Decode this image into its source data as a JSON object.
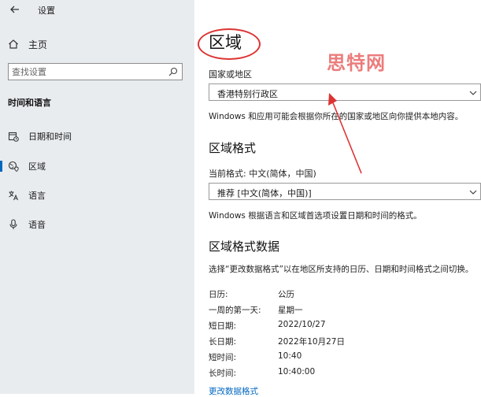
{
  "window": {
    "title": "设置"
  },
  "sidebar": {
    "home_label": "主页",
    "search_placeholder": "查找设置",
    "section_title": "时间和语言",
    "items": [
      {
        "label": "日期和时间",
        "icon": "calendar-clock-icon"
      },
      {
        "label": "区域",
        "icon": "region-icon"
      },
      {
        "label": "语言",
        "icon": "language-icon"
      },
      {
        "label": "语音",
        "icon": "microphone-icon"
      }
    ]
  },
  "main": {
    "title": "区域",
    "watermark": "思特网",
    "country_label": "国家或地区",
    "country_value": "香港特别行政区",
    "country_desc": "Windows 和应用可能会根据你所在的国家或地区向你提供本地内容。",
    "format_heading": "区域格式",
    "current_format_label": "当前格式: 中文(简体，中国)",
    "format_value": "推荐 [中文(简体，中国)]",
    "format_desc": "Windows 根据语言和区域首选项设置日期和时间的格式。",
    "data_heading": "区域格式数据",
    "data_desc": "选择“更改数据格式”以在地区所支持的日历、日期和时间格式之间切换。",
    "rows": [
      {
        "label": "日历:",
        "value": "公历"
      },
      {
        "label": "一周的第一天:",
        "value": "星期一"
      },
      {
        "label": "短日期:",
        "value": "2022/10/27"
      },
      {
        "label": "长日期:",
        "value": "2022年10月27日"
      },
      {
        "label": "短时间:",
        "value": "10:40"
      },
      {
        "label": "长时间:",
        "value": "10:40:00"
      }
    ],
    "change_link": "更改数据格式"
  },
  "colors": {
    "accent": "#0067c0",
    "annotation": "#dd3333",
    "sidebar_bg": "#e9ecef"
  }
}
